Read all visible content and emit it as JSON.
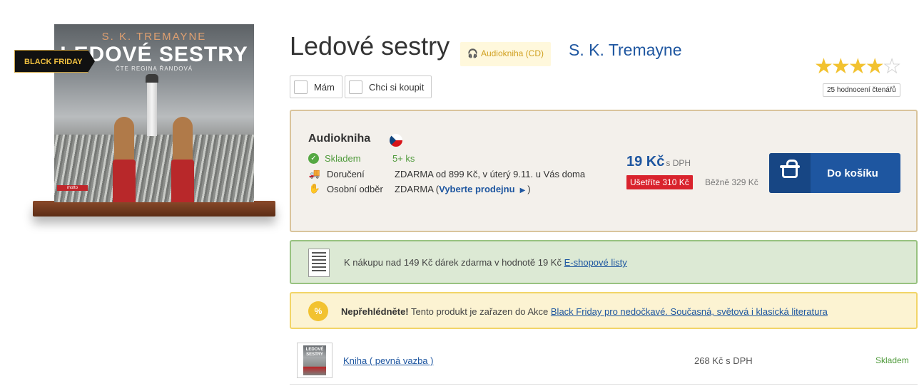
{
  "product": {
    "cover": {
      "author": "S. K. TREMAYNE",
      "title": "LEDOVÉ SESTRY",
      "reader": "ČTE REGINA ŘANDOVÁ",
      "publisher": "motto"
    },
    "badge": "BLACK FRIDAY",
    "title": "Ledové sestry",
    "format": "Audiokniha (CD)",
    "author": "S. K. Tremayne",
    "rating": {
      "value": 4,
      "max": 5,
      "count_label": "25 hodnocení čtenářů"
    },
    "checkboxes": [
      "Mám",
      "Chci si koupit"
    ]
  },
  "buybox": {
    "heading": "Audiokniha",
    "rows": [
      {
        "label": "Skladem",
        "value": "5+ ks"
      },
      {
        "label": "Doručení",
        "value": "ZDARMA od 899 Kč, v úterý 9.11. u Vás doma"
      },
      {
        "label": "Osobní odběr",
        "value_prefix": "ZDARMA (",
        "link": "Vyberte prodejnu",
        "value_suffix": ")"
      }
    ],
    "price": "19 Kč",
    "price_vat": "s DPH",
    "saving": "Ušetříte 310 Kč",
    "regular": "Běžně 329 Kč",
    "cart_button": "Do košíku"
  },
  "gift": {
    "text": "K nákupu nad 149 Kč dárek zdarma v hodnotě 19 Kč",
    "link": "E-shopové listy"
  },
  "promo": {
    "icon": "%",
    "strong": "Nepřehlédněte!",
    "text": "Tento produkt je zařazen do Akce",
    "link": "Black Friday pro nedočkavé. Současná, světová i klasická literatura"
  },
  "variant": {
    "thumb_title": "LEDOVÉ SESTRY",
    "name": "Kniha ( pevná vazba )",
    "price": "268 Kč s DPH",
    "stock": "Skladem"
  },
  "colors": {
    "accent": "#1e56a0",
    "sale": "#d9232d",
    "stock": "#4f9a3b",
    "star": "#f2c230"
  }
}
